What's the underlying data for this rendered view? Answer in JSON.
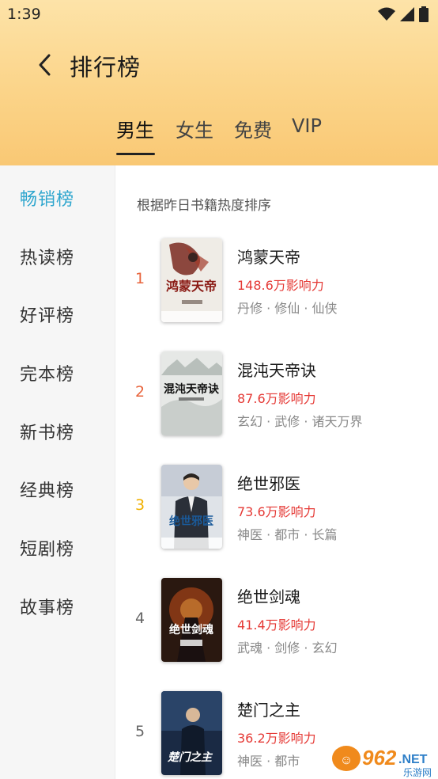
{
  "status": {
    "time": "1:39"
  },
  "header": {
    "title": "排行榜"
  },
  "tabs": [
    "男生",
    "女生",
    "免费",
    "VIP"
  ],
  "sidebar": {
    "items": [
      "畅销榜",
      "热读榜",
      "好评榜",
      "完本榜",
      "新书榜",
      "经典榜",
      "短剧榜",
      "故事榜"
    ]
  },
  "main": {
    "hint": "根据昨日书籍热度排序",
    "books": [
      {
        "rank": "1",
        "title": "鸿蒙天帝",
        "influence": "148.6万影响力",
        "tags": "丹修 · 修仙 · 仙侠",
        "cover_text": "鸿蒙天帝",
        "rank_color": "#e8643c"
      },
      {
        "rank": "2",
        "title": "混沌天帝诀",
        "influence": "87.6万影响力",
        "tags": "玄幻 · 武修 · 诸天万界",
        "cover_text": "混沌天帝诀",
        "rank_color": "#e8643c"
      },
      {
        "rank": "3",
        "title": "绝世邪医",
        "influence": "73.6万影响力",
        "tags": "神医 · 都市 · 长篇",
        "cover_text": "绝世邪医",
        "rank_color": "#f0b000"
      },
      {
        "rank": "4",
        "title": "绝世剑魂",
        "influence": "41.4万影响力",
        "tags": "武魂 · 剑修 · 玄幻",
        "cover_text": "绝世剑魂",
        "rank_color": "#666666"
      },
      {
        "rank": "5",
        "title": "楚门之主",
        "influence": "36.2万影响力",
        "tags": "神医 · 都市",
        "cover_text": "楚门之主",
        "rank_color": "#666666"
      }
    ]
  },
  "watermark": {
    "logo": "962",
    "suffix": ".NET",
    "sub": "乐游网"
  },
  "colors": {
    "accent": "#2fa6ce",
    "influence": "#e53935",
    "header_top": "#fde3a8",
    "header_bottom": "#f9c874"
  }
}
